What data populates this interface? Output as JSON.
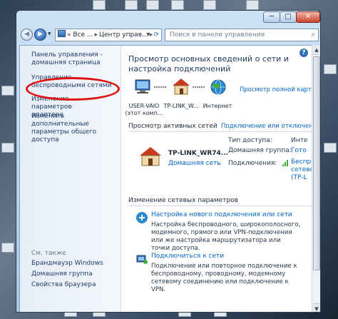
{
  "window": {
    "minimize": "─",
    "maximize": "□",
    "close": "✕"
  },
  "navbar": {
    "address_prefix": "«",
    "address_segments": [
      "Все ...",
      "Центр управ..."
    ],
    "address_separator": "▸",
    "search_placeholder": "Поиск в панели управления"
  },
  "sidebar": {
    "home_link": "Панель управления - домашняя страница",
    "items": [
      "Управление беспроводными сетями",
      "Изменение параметров адаптера",
      "Изменить дополнительные параметры общего доступа"
    ],
    "see_also_title": "См. также",
    "see_also": [
      "Брандмауэр Windows",
      "Домашняя группа",
      "Свойства браузера"
    ]
  },
  "main": {
    "title": "Просмотр основных сведений о сети и настройка подключений",
    "full_map_link": "Просмотр полной карты",
    "map_nodes": [
      {
        "label": "USER-VAIO (этот комп...",
        "icon": "computer-icon"
      },
      {
        "label": "TP-LINK_W...",
        "icon": "house-icon"
      },
      {
        "label": "Интернет",
        "icon": "globe-icon"
      }
    ],
    "active_title": "Просмотр активных сетей",
    "connect_link": "Подключение или отключение",
    "network": {
      "name": "TP-LINK_WR74...",
      "type": "Домашняя сеть",
      "props": [
        {
          "label": "Тип доступа:",
          "value": "Инте"
        },
        {
          "label": "Домашняя группа:",
          "value": "Гото"
        },
        {
          "label": "Подключения:",
          "value": "Беспр... сетево... (TP-L"
        }
      ]
    },
    "change_title": "Изменение сетевых параметров",
    "tasks": [
      {
        "link": "Настройка нового подключения или сети",
        "desc": "Настройка беспроводного, широкополосного, модемного, прямого или VPN-подключения или же настройка маршрутизатора или точки доступа."
      },
      {
        "link": "Подключиться к сети",
        "desc": "Подключение или повторное подключение к беспроводному, проводному, модемному сетевому соединению или подключение к VPN."
      }
    ]
  },
  "colors": {
    "accent": "#0066cc",
    "highlight": "#e01010"
  }
}
